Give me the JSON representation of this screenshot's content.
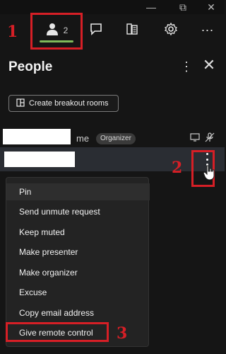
{
  "window": {
    "minimize_glyph": "—",
    "maximize_glyph": "⧉",
    "close_glyph": "✕"
  },
  "toolbar": {
    "people_count": "2",
    "more_glyph": "⋯",
    "icons": {
      "people": "people-icon",
      "chat": "chat-icon",
      "notes": "notes-icon",
      "settings": "gear-icon",
      "more": "more-icon"
    }
  },
  "panel": {
    "title": "People",
    "more_glyph": "⋮",
    "close_glyph": "✕"
  },
  "breakout": {
    "label": "Create breakout rooms",
    "icon": "breakout-icon"
  },
  "participants": {
    "me_label": "me",
    "organizer_badge": "Organizer"
  },
  "context_menu": {
    "items": [
      "Pin",
      "Send unmute request",
      "Keep muted",
      "Make presenter",
      "Make organizer",
      "Excuse",
      "Copy email address",
      "Give remote control"
    ]
  },
  "annotations": {
    "step1": "1",
    "step2": "2",
    "step3": "3",
    "color": "#d61f26"
  },
  "colors": {
    "accent_underline": "#7fba5a",
    "background": "#151515",
    "selected_row": "#2a2d33"
  }
}
